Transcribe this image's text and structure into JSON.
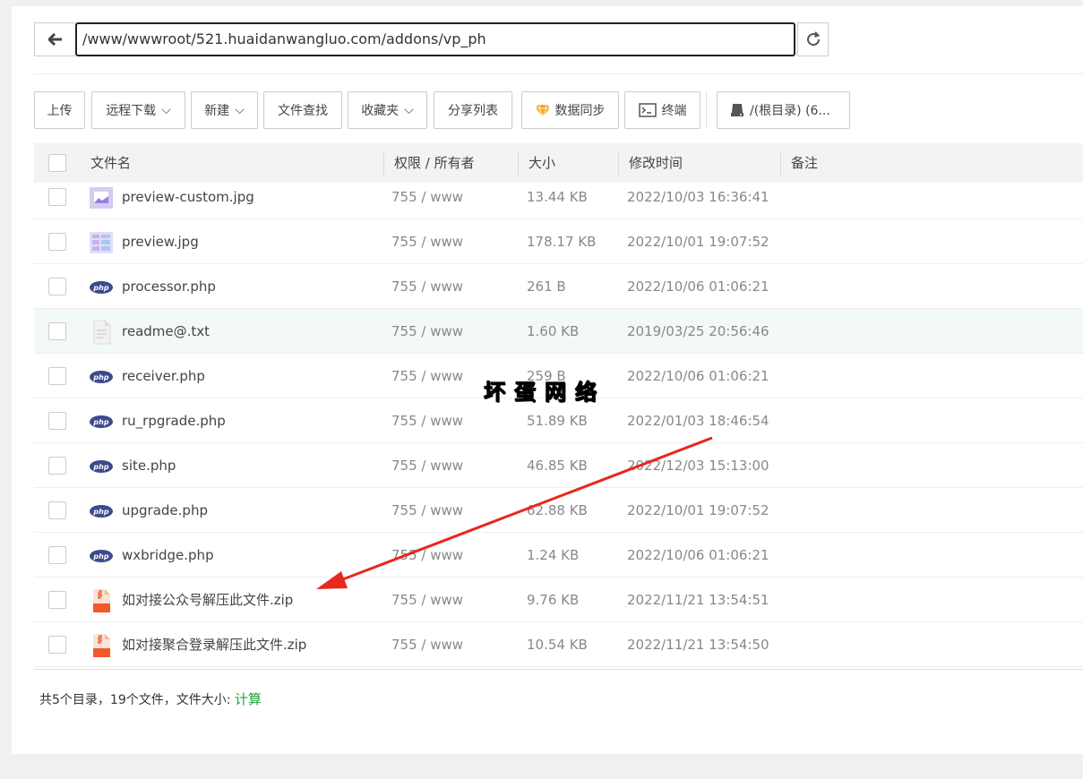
{
  "address": {
    "path": "/www/wwwroot/521.huaidanwangluo.com/addons/vp_ph"
  },
  "toolbar": {
    "upload": "上传",
    "remote_download": "远程下载",
    "new": "新建",
    "file_search": "文件查找",
    "favorites": "收藏夹",
    "share_list": "分享列表",
    "data_sync": "数据同步",
    "terminal": "终端",
    "disk": "/(根目录) (6..."
  },
  "table": {
    "headers": {
      "name": "文件名",
      "perm": "权限 / 所有者",
      "size": "大小",
      "mtime": "修改时间",
      "note": "备注"
    },
    "rows": [
      {
        "name": "preview-custom.jpg",
        "perm": "755 / www",
        "size": "13.44 KB",
        "mtime": "2022/10/03 16:36:41",
        "icon": "image-icon"
      },
      {
        "name": "preview.jpg",
        "perm": "755 / www",
        "size": "178.17 KB",
        "mtime": "2022/10/01 19:07:52",
        "icon": "image-icon"
      },
      {
        "name": "processor.php",
        "perm": "755 / www",
        "size": "261 B",
        "mtime": "2022/10/06 01:06:21",
        "icon": "php-icon"
      },
      {
        "name": "readme@.txt",
        "perm": "755 / www",
        "size": "1.60 KB",
        "mtime": "2019/03/25 20:56:46",
        "icon": "text-file-icon"
      },
      {
        "name": "receiver.php",
        "perm": "755 / www",
        "size": "259 B",
        "mtime": "2022/10/06 01:06:21",
        "icon": "php-icon"
      },
      {
        "name": "ru_rpgrade.php",
        "perm": "755 / www",
        "size": "51.89 KB",
        "mtime": "2022/01/03 18:46:54",
        "icon": "php-icon"
      },
      {
        "name": "site.php",
        "perm": "755 / www",
        "size": "46.85 KB",
        "mtime": "2022/12/03 15:13:00",
        "icon": "php-icon"
      },
      {
        "name": "upgrade.php",
        "perm": "755 / www",
        "size": "62.88 KB",
        "mtime": "2022/10/01 19:07:52",
        "icon": "php-icon"
      },
      {
        "name": "wxbridge.php",
        "perm": "755 / www",
        "size": "1.24 KB",
        "mtime": "2022/10/06 01:06:21",
        "icon": "php-icon"
      },
      {
        "name": "如对接公众号解压此文件.zip",
        "perm": "755 / www",
        "size": "9.76 KB",
        "mtime": "2022/11/21 13:54:51",
        "icon": "zip-icon"
      },
      {
        "name": "如对接聚合登录解压此文件.zip",
        "perm": "755 / www",
        "size": "10.54 KB",
        "mtime": "2022/11/21 13:54:50",
        "icon": "zip-icon"
      }
    ]
  },
  "footer": {
    "summary": "共5个目录，19个文件，文件大小:",
    "calc": "计算"
  },
  "watermark": "坏蛋网络",
  "colors": {
    "accent_green": "#20a53a",
    "annotation_red": "#e8271d",
    "row_highlight": "#f3f9f7"
  }
}
